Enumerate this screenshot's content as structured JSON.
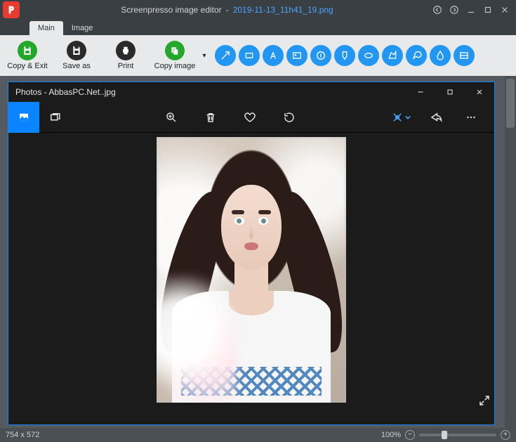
{
  "titlebar": {
    "app_name": "Screenpresso image editor",
    "separator": "-",
    "file_name": "2019-11-13_11h41_19.png"
  },
  "tabs": {
    "main": "Main",
    "image": "Image"
  },
  "ribbon": {
    "copy_exit": "Copy & Exit",
    "save_as": "Save as",
    "print": "Print",
    "copy_image": "Copy image"
  },
  "tools": {
    "names": [
      "arrow-tool",
      "rect-tool",
      "text-tool",
      "image-tool",
      "number-tool",
      "highlight-tool",
      "ellipse-tool",
      "polygon-tool",
      "callout-tool",
      "blur-tool",
      "magnify-tool"
    ]
  },
  "photos_window": {
    "title": "Photos - AbbasPC.Net..jpg"
  },
  "statusbar": {
    "dimensions": "754 x 572",
    "zoom_pct": "100%"
  },
  "colors": {
    "accent_blue": "#0a84ff",
    "ribbon_green": "#24a82b",
    "tool_blue": "#2196f3"
  }
}
